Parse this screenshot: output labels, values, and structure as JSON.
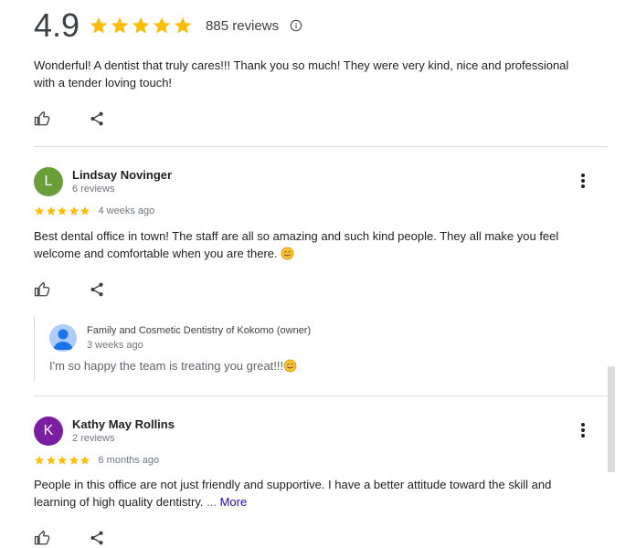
{
  "summary": {
    "rating": "4.9",
    "stars": 5,
    "review_count": "885 reviews",
    "info_icon": "info-icon"
  },
  "top_review": {
    "text_line1": "Wonderful! A dentist that truly cares!!! Thank you so much! They were very kind, nice and professional",
    "text_line2": "with a tender loving touch!"
  },
  "reviews": [
    {
      "initial": "L",
      "avatar_color": "#689f38",
      "name": "Lindsay Novinger",
      "sub": "6 reviews",
      "rating": 5,
      "time": "4 weeks ago",
      "text_line1": "Best dental office in town! The staff are all so amazing and such kind people. They all make you feel",
      "text_line2": "welcome and comfortable when you are there.",
      "owner_reply": {
        "name": "Family and Cosmetic Dentistry of Kokomo (owner)",
        "time": "3 weeks ago",
        "text": "I'm so happy the team is treating you great!!!"
      }
    },
    {
      "initial": "K",
      "avatar_color": "#7b1fa2",
      "name": "Kathy May Rollins",
      "sub": "2 reviews",
      "rating": 5,
      "time": "6 months ago",
      "text_line1": "People in this office are not just friendly and supportive. I have a better attitude toward the skill and",
      "text_line2": "learning of high quality dentistry.",
      "ellipsis": "...",
      "more_label": "More"
    }
  ],
  "colors": {
    "star": "#fbbc04",
    "divider": "#dadce0",
    "link": "#1a0dab"
  },
  "icons": {
    "like": "thumbs-up-icon",
    "share": "share-icon",
    "menu": "more-vert-icon",
    "emoji": "smiling-face-icon"
  }
}
